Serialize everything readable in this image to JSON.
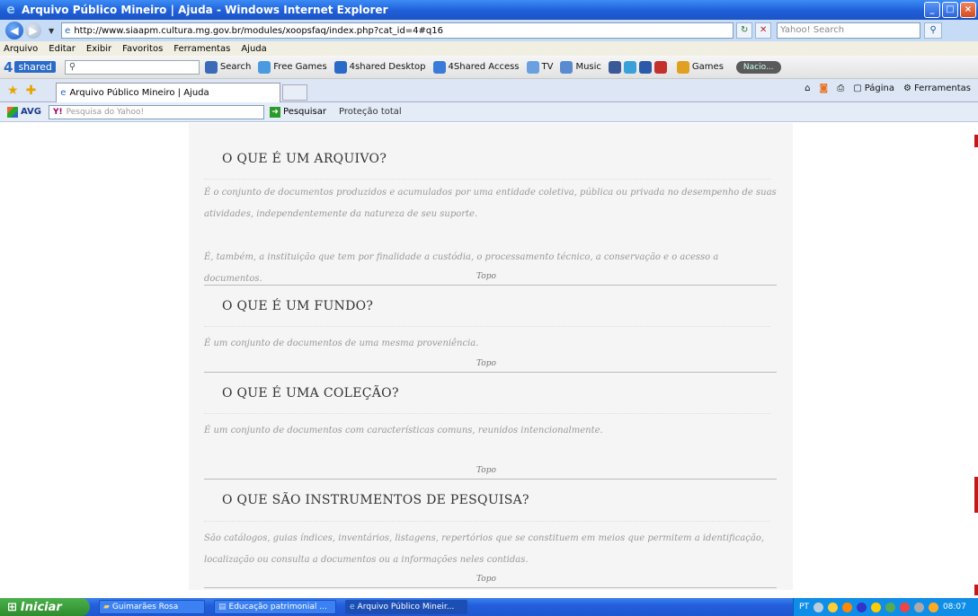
{
  "window": {
    "title": "Arquivo Público Mineiro | Ajuda - Windows Internet Explorer"
  },
  "address": {
    "url": "http://www.siaapm.cultura.mg.gov.br/modules/xoopsfaq/index.php?cat_id=4#q16",
    "search_placeholder": "Yahoo! Search"
  },
  "menu": [
    "Arquivo",
    "Editar",
    "Exibir",
    "Favoritos",
    "Ferramentas",
    "Ajuda"
  ],
  "toolbar": {
    "brand_num": "4",
    "brand_label": "shared",
    "search_label": "Search",
    "items": [
      "Free Games",
      "4shared Desktop",
      "4Shared Access",
      "TV",
      "Music",
      "Games"
    ],
    "radio_label": "Nacio..."
  },
  "tabs": {
    "active_title": "Arquivo Público Mineiro | Ajuda"
  },
  "commands": [
    "Página",
    "Ferramentas"
  ],
  "avg": {
    "brand": "AVG",
    "search_placeholder": "Pesquisa do Yahoo!",
    "search_button": "Pesquisar",
    "protection": "Proteção total"
  },
  "faq": [
    {
      "question": "O QUE É UM ARQUIVO?",
      "answers": [
        "É o conjunto de documentos produzidos e acumulados por uma entidade coletiva, pública ou privada no desempenho de suas atividades, independentemente da natureza de seu suporte.",
        "É, também, a instituição que tem por finalidade a custódia, o processamento técnico, a conservação e o acesso a documentos."
      ],
      "top_link": "Topo"
    },
    {
      "question": "O QUE É UM FUNDO?",
      "answers": [
        "É um conjunto de documentos de uma mesma proveniência."
      ],
      "top_link": "Topo"
    },
    {
      "question": "O QUE É UMA COLEÇÃO?",
      "answers": [
        "É um conjunto de documentos com características comuns, reunidos intencionalmente."
      ],
      "top_link": "Topo"
    },
    {
      "question": "O QUE SÃO INSTRUMENTOS DE PESQUISA?",
      "answers": [
        "São catálogos, guias índices, inventários, listagens, repertórios que se constituem em meios que permitem a identificação, localização ou consulta a documentos ou a informações neles contidas."
      ],
      "top_link": "Topo"
    }
  ],
  "taskbar": {
    "start": "Iniciar",
    "tasks": [
      "Guimarães Rosa",
      "Educação patrimonial ...",
      "Arquivo Público Mineir..."
    ],
    "lang": "PT",
    "clock": "08:07"
  }
}
